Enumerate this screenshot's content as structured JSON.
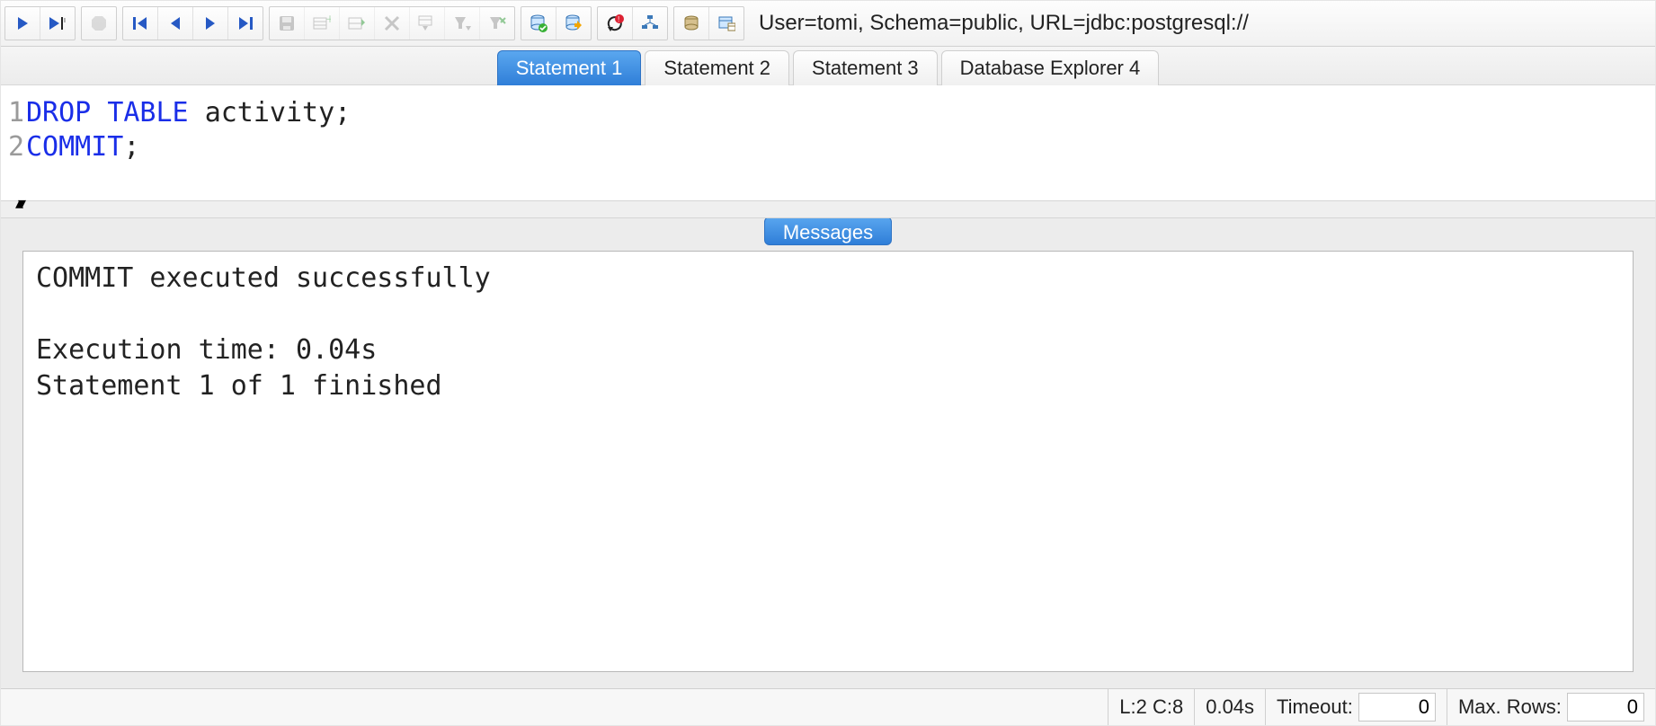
{
  "connection_info": "User=tomi, Schema=public, URL=jdbc:postgresql://",
  "tabs": [
    {
      "label": "Statement 1",
      "active": true
    },
    {
      "label": "Statement 2",
      "active": false
    },
    {
      "label": "Statement 3",
      "active": false
    },
    {
      "label": "Database Explorer 4",
      "active": false
    }
  ],
  "editor": {
    "lines": [
      {
        "num": "1",
        "tokens": [
          {
            "t": "DROP ",
            "c": "kw"
          },
          {
            "t": "TABLE ",
            "c": "kw"
          },
          {
            "t": "activity;",
            "c": "tok"
          }
        ]
      },
      {
        "num": "2",
        "tokens": [
          {
            "t": "COMMIT",
            "c": "kw"
          },
          {
            "t": ";",
            "c": "tok"
          }
        ]
      }
    ]
  },
  "messages_tab_label": "Messages",
  "messages_text": "COMMIT executed successfully\n\nExecution time: 0.04s\nStatement 1 of 1 finished",
  "status": {
    "cursor": "L:2 C:8",
    "exec_time": "0.04s",
    "timeout_label": "Timeout:",
    "timeout_value": "0",
    "maxrows_label": "Max. Rows:",
    "maxrows_value": "0"
  },
  "toolbar_icons": {
    "run": "run-icon",
    "run_cursor": "run-cursor-icon",
    "stop": "stop-icon",
    "first": "first-record-icon",
    "prev": "prev-record-icon",
    "next": "next-record-icon",
    "last": "last-record-icon",
    "save": "save-icon",
    "insert_row": "insert-row-icon",
    "copy_row": "copy-row-icon",
    "delete_row": "delete-row-icon",
    "filter": "filter-select-icon",
    "filter_dd": "filter-dropdown-icon",
    "filter_clear": "filter-clear-icon",
    "commit": "commit-icon",
    "rollback": "rollback-icon",
    "stop_on_error": "stop-on-error-icon",
    "explain": "explain-plan-icon",
    "db1": "db-tool1-icon",
    "db2": "db-tool2-icon"
  }
}
